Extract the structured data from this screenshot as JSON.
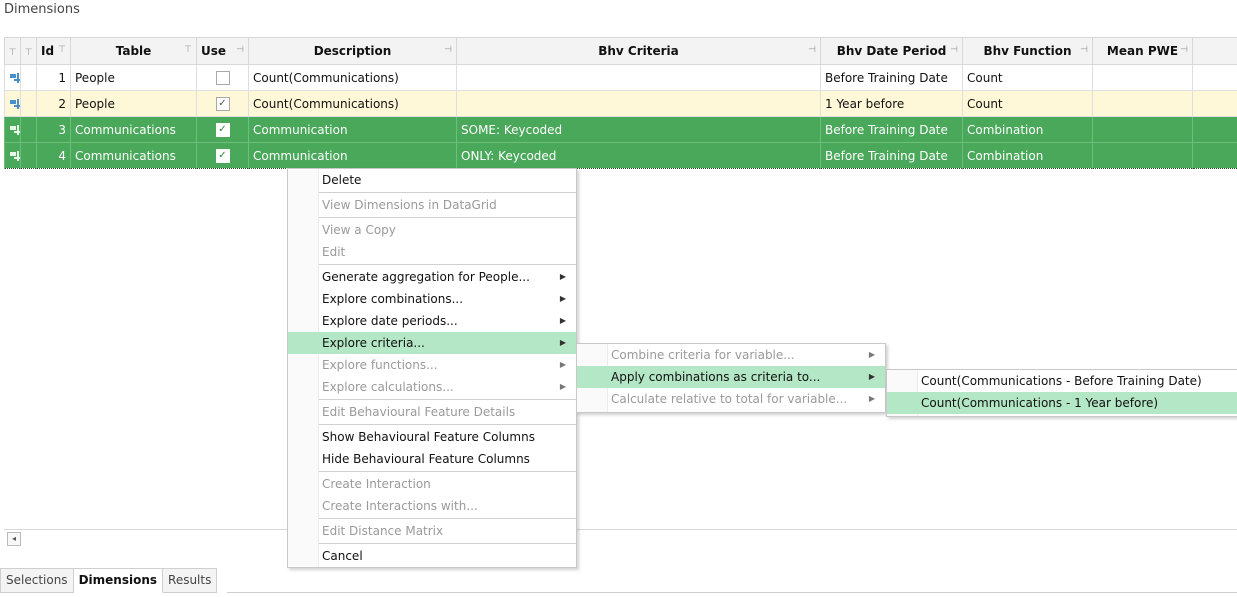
{
  "panel": {
    "title": "Dimensions"
  },
  "grid": {
    "columns": [
      "Id",
      "Table",
      "Use",
      "Description",
      "Bhv Criteria",
      "Bhv Date Period",
      "Bhv Function",
      "Mean PWE"
    ],
    "rows": [
      {
        "id": "1",
        "table": "People",
        "use": "",
        "description": "Count(Communications)",
        "criteria": "",
        "period": "Before Training Date",
        "function": "Count",
        "mean": ""
      },
      {
        "id": "2",
        "table": "People",
        "use": "✓",
        "description": "Count(Communications)",
        "criteria": "",
        "period": "1 Year before",
        "function": "Count",
        "mean": ""
      },
      {
        "id": "3",
        "table": "Communications",
        "use": "✓",
        "description": "Communication",
        "criteria": "SOME: Keycoded",
        "period": "Before Training Date",
        "function": "Combination",
        "mean": ""
      },
      {
        "id": "4",
        "table": "Communications",
        "use": "✓",
        "description": "Communication",
        "criteria": "ONLY: Keycoded",
        "period": "Before Training Date",
        "function": "Combination",
        "mean": ""
      }
    ]
  },
  "tabs": [
    "Selections",
    "Dimensions",
    "Results"
  ],
  "context_menu": {
    "items": [
      "Delete",
      "View Dimensions in DataGrid",
      "View a Copy",
      "Edit",
      "Generate aggregation for People...",
      "Explore combinations...",
      "Explore date periods...",
      "Explore criteria...",
      "Explore functions...",
      "Explore calculations...",
      "Edit Behavioural Feature Details",
      "Show Behavioural Feature Columns",
      "Hide Behavioural Feature Columns",
      "Create Interaction",
      "Create Interactions with...",
      "Edit Distance Matrix",
      "Cancel"
    ]
  },
  "submenu_criteria": {
    "items": [
      "Combine criteria for variable...",
      "Apply combinations as criteria to...",
      "Calculate relative to total for variable..."
    ]
  },
  "submenu_apply": {
    "items": [
      "Count(Communications - Before Training Date)",
      "Count(Communications - 1 Year before)"
    ]
  },
  "colors": {
    "selected_row": "#4aa85a",
    "menu_highlight": "#b3e7c5",
    "yellow_row": "#fff8d8"
  }
}
